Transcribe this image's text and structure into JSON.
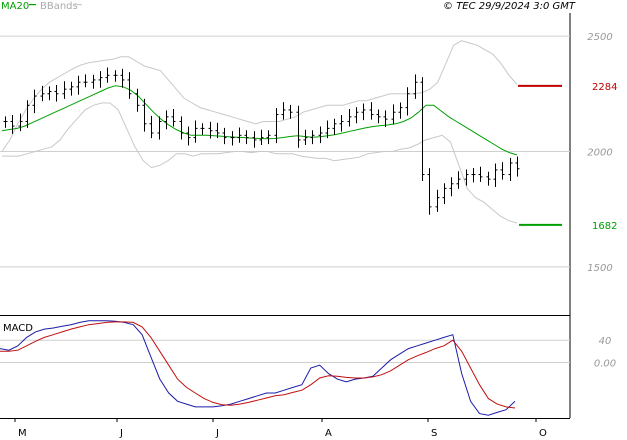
{
  "header": {
    "legend_ma": "MA20",
    "legend_bb": "BBands",
    "copyright": "© TEC 29/9/2024 3:0 GMT"
  },
  "macd_label": "MACD",
  "colors": {
    "price": "#000000",
    "ma": "#00a000",
    "bbands": "#c8c8c8",
    "resistance": "#c00000",
    "support": "#00a000",
    "macd": "#1c1ca8",
    "signal": "#c01010",
    "grid": "#cfcfcf"
  },
  "chart_data": [
    {
      "type": "line",
      "panel": "price",
      "x_labels": [
        "M",
        "J",
        "J",
        "A",
        "S",
        "O"
      ],
      "y_ticks": [
        "2500",
        "2000",
        "1500"
      ],
      "ylim": [
        1300,
        2600
      ],
      "levels": [
        {
          "label": "2284",
          "value": 2284
        },
        {
          "label": "1682",
          "value": 1682
        }
      ],
      "series": [
        {
          "values": [
            2130,
            2110,
            2130,
            2200,
            2240,
            2250,
            2260,
            2250,
            2270,
            2280,
            2300,
            2300,
            2310,
            2320,
            2330,
            2330,
            2310,
            2250,
            2200,
            2120,
            2080,
            2130,
            2150,
            2130,
            2080,
            2060,
            2100,
            2100,
            2090,
            2080,
            2060,
            2060,
            2070,
            2060,
            2050,
            2060,
            2070,
            2160,
            2180,
            2170,
            2050,
            2060,
            2070,
            2080,
            2100,
            2120,
            2130,
            2150,
            2170,
            2180,
            2160,
            2150,
            2140,
            2170,
            2190,
            2250,
            2300,
            1900,
            1760,
            1800,
            1840,
            1860,
            1880,
            1900,
            1900,
            1890,
            1880,
            1920,
            1900,
            1950,
            1925
          ],
          "role": "close"
        },
        {
          "values": [
            2090,
            2095,
            2100,
            2110,
            2125,
            2140,
            2155,
            2170,
            2185,
            2200,
            2215,
            2230,
            2245,
            2260,
            2275,
            2285,
            2280,
            2265,
            2240,
            2205,
            2170,
            2140,
            2115,
            2095,
            2080,
            2070,
            2070,
            2070,
            2068,
            2066,
            2064,
            2062,
            2060,
            2058,
            2056,
            2055,
            2056,
            2060,
            2065,
            2068,
            2065,
            2062,
            2064,
            2068,
            2073,
            2080,
            2088,
            2095,
            2102,
            2108,
            2112,
            2115,
            2120,
            2130,
            2145,
            2170,
            2200,
            2200,
            2175,
            2150,
            2130,
            2110,
            2090,
            2070,
            2050,
            2030,
            2010,
            1995,
            1985
          ],
          "role": "ma20"
        },
        {
          "values": [
            2000,
            2050,
            2120,
            2180,
            2230,
            2270,
            2300,
            2320,
            2340,
            2360,
            2375,
            2385,
            2390,
            2395,
            2400,
            2410,
            2410,
            2390,
            2370,
            2360,
            2350,
            2310,
            2270,
            2230,
            2210,
            2190,
            2180,
            2170,
            2160,
            2150,
            2140,
            2130,
            2120,
            2130,
            2130,
            2130,
            2140,
            2150,
            2170,
            2180,
            2190,
            2200,
            2200,
            2200,
            2210,
            2220,
            2220,
            2230,
            2240,
            2250,
            2250,
            2250,
            2250,
            2255,
            2270,
            2300,
            2380,
            2460,
            2480,
            2470,
            2460,
            2440,
            2420,
            2380,
            2330,
            2290
          ],
          "role": "bb_upper"
        },
        {
          "values": [
            1980,
            1980,
            1980,
            1990,
            2000,
            2010,
            2020,
            2050,
            2100,
            2140,
            2180,
            2200,
            2210,
            2210,
            2180,
            2100,
            2020,
            1960,
            1930,
            1940,
            1960,
            1990,
            1990,
            1980,
            1990,
            1990,
            1990,
            1995,
            2000,
            2000,
            1995,
            2000,
            2000,
            1990,
            1990,
            1990,
            1980,
            1975,
            1970,
            1970,
            1960,
            1965,
            1970,
            1975,
            1990,
            1995,
            2000,
            2000,
            2010,
            2015,
            2030,
            2050,
            2060,
            2070,
            2040,
            1940,
            1840,
            1800,
            1780,
            1750,
            1720,
            1700,
            1690
          ],
          "role": "bb_lower"
        }
      ]
    },
    {
      "type": "line",
      "panel": "macd",
      "y_ticks": [
        "40",
        "0.00"
      ],
      "ylim": [
        -100,
        80
      ],
      "series": [
        {
          "values": [
            25,
            22,
            30,
            45,
            55,
            60,
            62,
            65,
            68,
            72,
            75,
            75,
            75,
            74,
            72,
            68,
            50,
            10,
            -30,
            -55,
            -70,
            -75,
            -80,
            -80,
            -80,
            -78,
            -75,
            -70,
            -65,
            -60,
            -55,
            -55,
            -50,
            -45,
            -40,
            -10,
            -5,
            -20,
            -30,
            -35,
            -30,
            -28,
            -25,
            -10,
            5,
            15,
            25,
            30,
            35,
            40,
            45,
            50,
            -20,
            -70,
            -92,
            -95,
            -90,
            -85,
            -70
          ],
          "role": "macd"
        },
        {
          "values": [
            20,
            20,
            22,
            30,
            38,
            45,
            50,
            55,
            60,
            64,
            68,
            70,
            72,
            73,
            73,
            72,
            64,
            45,
            20,
            -5,
            -30,
            -45,
            -55,
            -65,
            -72,
            -76,
            -77,
            -75,
            -72,
            -68,
            -64,
            -60,
            -58,
            -54,
            -50,
            -40,
            -28,
            -24,
            -25,
            -27,
            -28,
            -28,
            -26,
            -22,
            -15,
            -5,
            5,
            12,
            18,
            25,
            30,
            40,
            20,
            -10,
            -40,
            -65,
            -75,
            -80,
            -82
          ],
          "role": "signal"
        }
      ]
    }
  ]
}
